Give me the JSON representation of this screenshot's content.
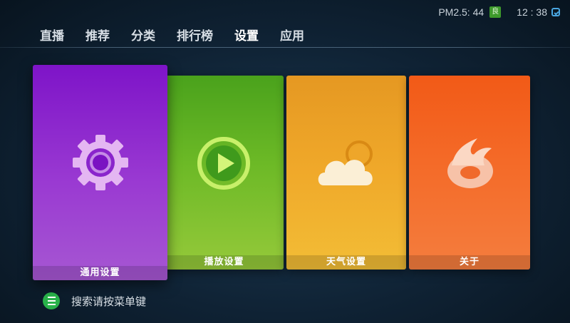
{
  "status": {
    "pm25": "PM2.5: 44",
    "pm_badge": "良",
    "time": "12 : 38"
  },
  "tabs": [
    {
      "label": "直播"
    },
    {
      "label": "推荐"
    },
    {
      "label": "分类"
    },
    {
      "label": "排行榜"
    },
    {
      "label": "设置",
      "active": true
    },
    {
      "label": "应用"
    }
  ],
  "tiles": [
    {
      "label": "通用设置",
      "icon": "gear-icon",
      "color": "#8a24cc",
      "focused": true
    },
    {
      "label": "播放设置",
      "icon": "play-icon",
      "color": "#5fae22"
    },
    {
      "label": "天气设置",
      "icon": "weather-cloud-icon",
      "color": "#eca228"
    },
    {
      "label": "关于",
      "icon": "app-logo-icon",
      "color": "#f3621f"
    }
  ],
  "hint": {
    "icon": "menu-icon",
    "text": "搜索请按菜单键",
    "color": "#29b24a"
  }
}
